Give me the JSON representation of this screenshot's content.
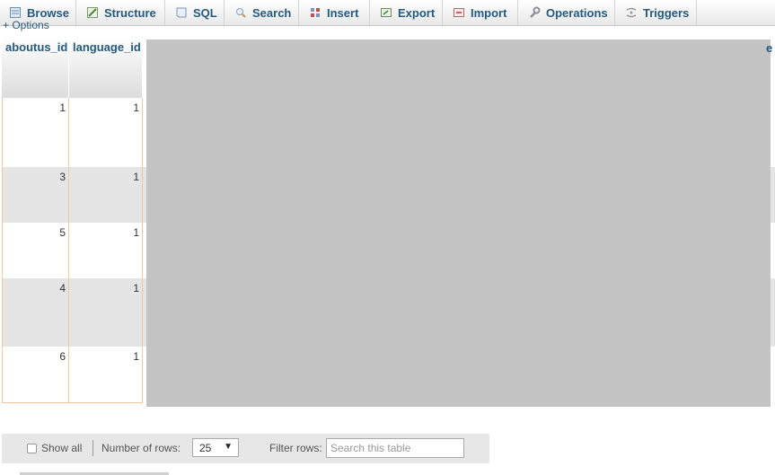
{
  "tabs": [
    {
      "label": "Browse",
      "icon": "browse-icon"
    },
    {
      "label": "Structure",
      "icon": "structure-icon"
    },
    {
      "label": "SQL",
      "icon": "sql-icon"
    },
    {
      "label": "Search",
      "icon": "search-icon"
    },
    {
      "label": "Insert",
      "icon": "insert-icon"
    },
    {
      "label": "Export",
      "icon": "export-icon"
    },
    {
      "label": "Import",
      "icon": "import-icon"
    },
    {
      "label": "Operations",
      "icon": "operations-icon"
    },
    {
      "label": "Triggers",
      "icon": "triggers-icon"
    }
  ],
  "options_link": "+ Options",
  "table": {
    "columns": [
      "aboutus_id",
      "language_id"
    ],
    "rows": [
      {
        "aboutus_id": "1",
        "language_id": "1"
      },
      {
        "aboutus_id": "3",
        "language_id": "1"
      },
      {
        "aboutus_id": "5",
        "language_id": "1"
      },
      {
        "aboutus_id": "4",
        "language_id": "1"
      },
      {
        "aboutus_id": "6",
        "language_id": "1"
      }
    ],
    "edge_header_fragment": "e"
  },
  "navbar": {
    "show_all_label": "Show all",
    "rows_label": "Number of rows:",
    "rows_value": "25",
    "filter_label": "Filter rows:",
    "filter_placeholder": "Search this table"
  },
  "colors": {
    "link": "#235a81",
    "row_alt": "#e5e5e5",
    "grid_line": "#f3c7a0",
    "redaction": "#c4c4c4"
  }
}
